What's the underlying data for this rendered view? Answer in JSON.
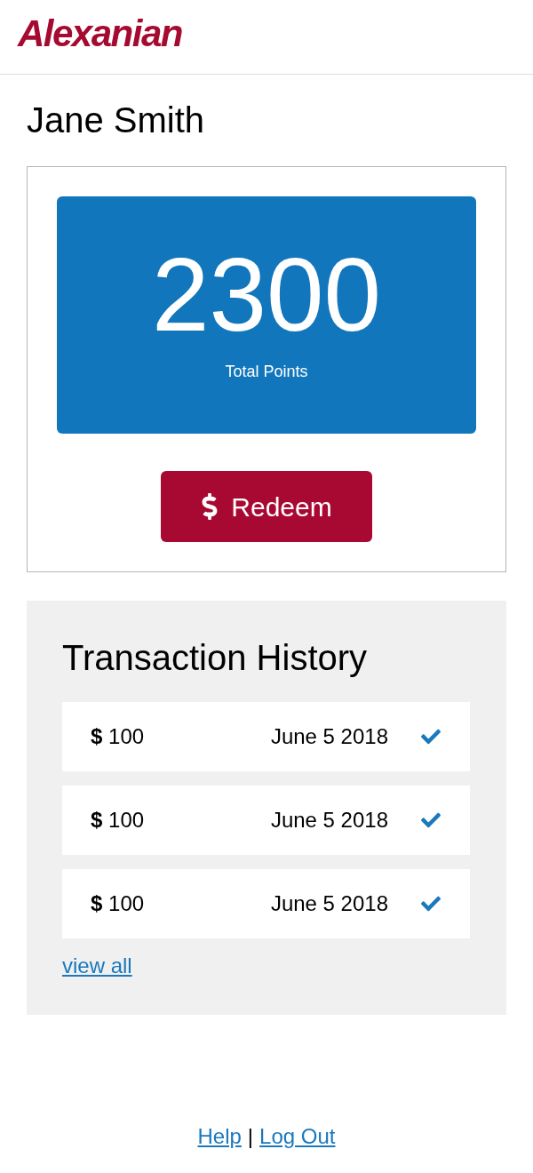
{
  "header": {
    "logo": "Alexanian"
  },
  "user": {
    "name": "Jane Smith"
  },
  "points": {
    "value": "2300",
    "label": "Total Points"
  },
  "redeem_button": {
    "label": "Redeem"
  },
  "transaction_history": {
    "title": "Transaction History",
    "rows": [
      {
        "amount": "**$** 100",
        "date": "June 5 2018",
        "completed": true
      },
      {
        "amount": "**$** 100",
        "date": "June 5 2018",
        "completed": true
      },
      {
        "amount": "**$** 100",
        "date": "June 5 2018",
        "completed": true
      }
    ],
    "view_all": "view all"
  },
  "footer": {
    "links": [
      "Help",
      "Log Out"
    ],
    "separator": "|"
  }
}
